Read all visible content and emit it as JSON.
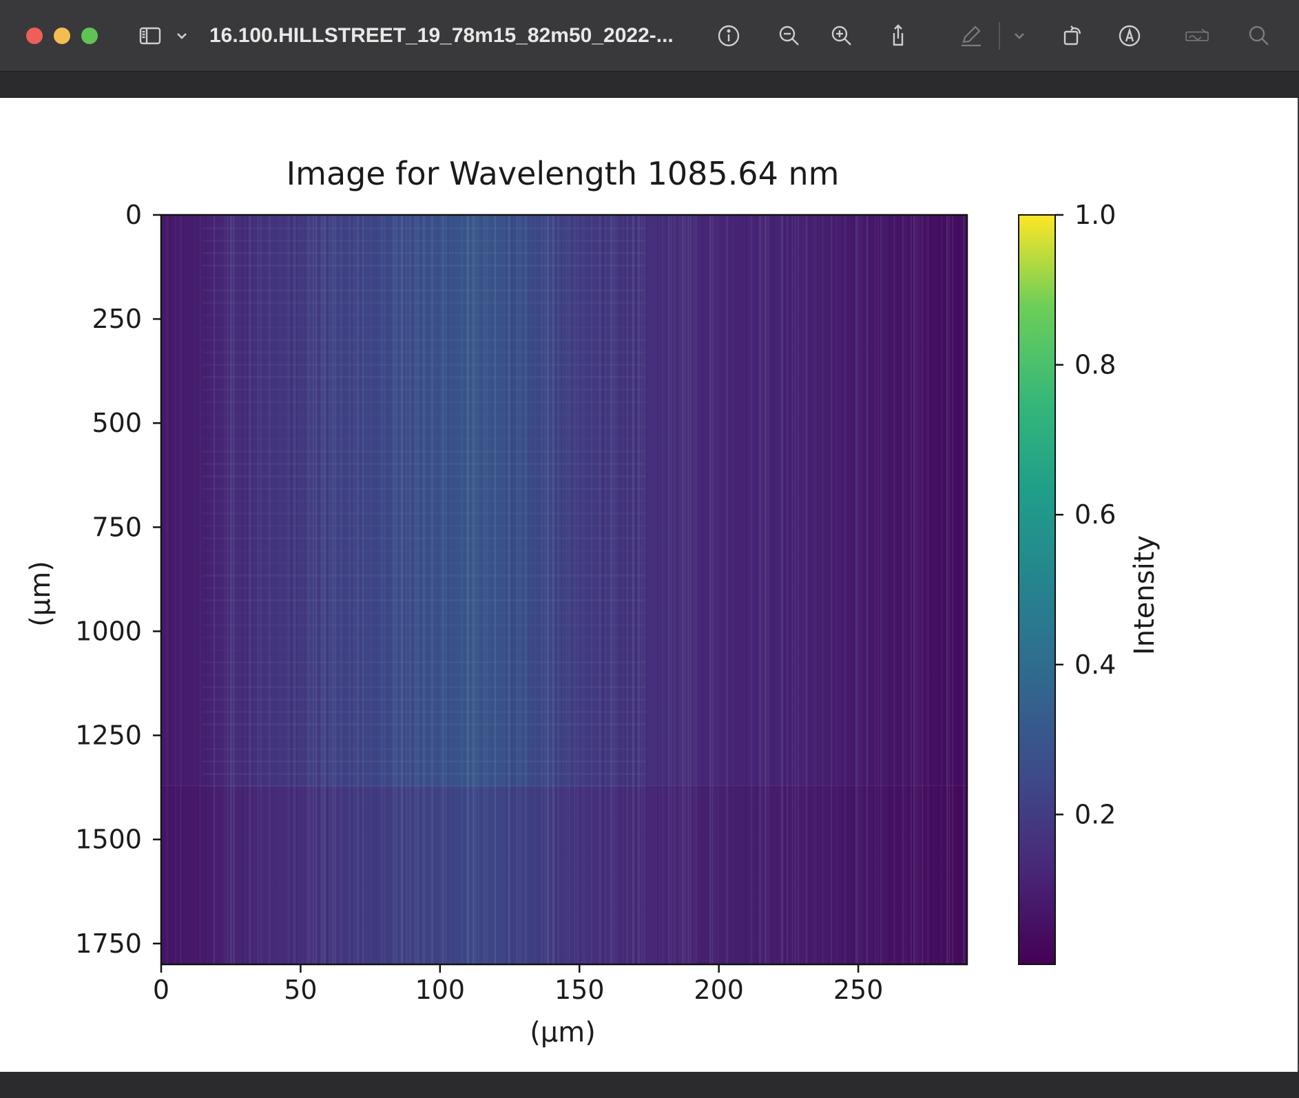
{
  "window": {
    "title": "16.100.HILLSTREET_19_78m15_82m50_2022-...",
    "traffic_lights": [
      "close",
      "minimize",
      "zoom"
    ],
    "toolbar_icons": [
      "sidebar-icon",
      "chevron-down-icon",
      "info-icon",
      "zoom-out-icon",
      "zoom-in-icon",
      "share-icon",
      "markup-pen-icon",
      "chevron-down-icon",
      "rotate-icon",
      "annotate-icon",
      "signature-icon",
      "search-icon"
    ]
  },
  "chart_data": {
    "type": "heatmap",
    "title": "Image for Wavelength 1085.64 nm",
    "xlabel": "(µm)",
    "ylabel": "(µm)",
    "xlim": [
      0,
      289
    ],
    "ylim": [
      1800,
      0
    ],
    "xticks": [
      "0",
      "50",
      "100",
      "150",
      "200",
      "250"
    ],
    "yticks": [
      "0",
      "250",
      "500",
      "750",
      "1000",
      "1250",
      "1500",
      "1750"
    ],
    "colorbar": {
      "label": "Intensity",
      "colormap": "viridis",
      "range": [
        0,
        1
      ],
      "ticks": [
        "0.2",
        "0.4",
        "0.6",
        "0.8",
        "1.0"
      ]
    },
    "step_row": 1370,
    "column_profile": [
      {
        "x": 0,
        "v": 0.08
      },
      {
        "x": 15,
        "v": 0.1
      },
      {
        "x": 25,
        "v": 0.14
      },
      {
        "x": 50,
        "v": 0.19
      },
      {
        "x": 75,
        "v": 0.24
      },
      {
        "x": 100,
        "v": 0.28
      },
      {
        "x": 110,
        "v": 0.3
      },
      {
        "x": 130,
        "v": 0.27
      },
      {
        "x": 150,
        "v": 0.2
      },
      {
        "x": 180,
        "v": 0.15
      },
      {
        "x": 200,
        "v": 0.12
      },
      {
        "x": 230,
        "v": 0.11
      },
      {
        "x": 260,
        "v": 0.07
      },
      {
        "x": 289,
        "v": 0.04
      }
    ]
  }
}
